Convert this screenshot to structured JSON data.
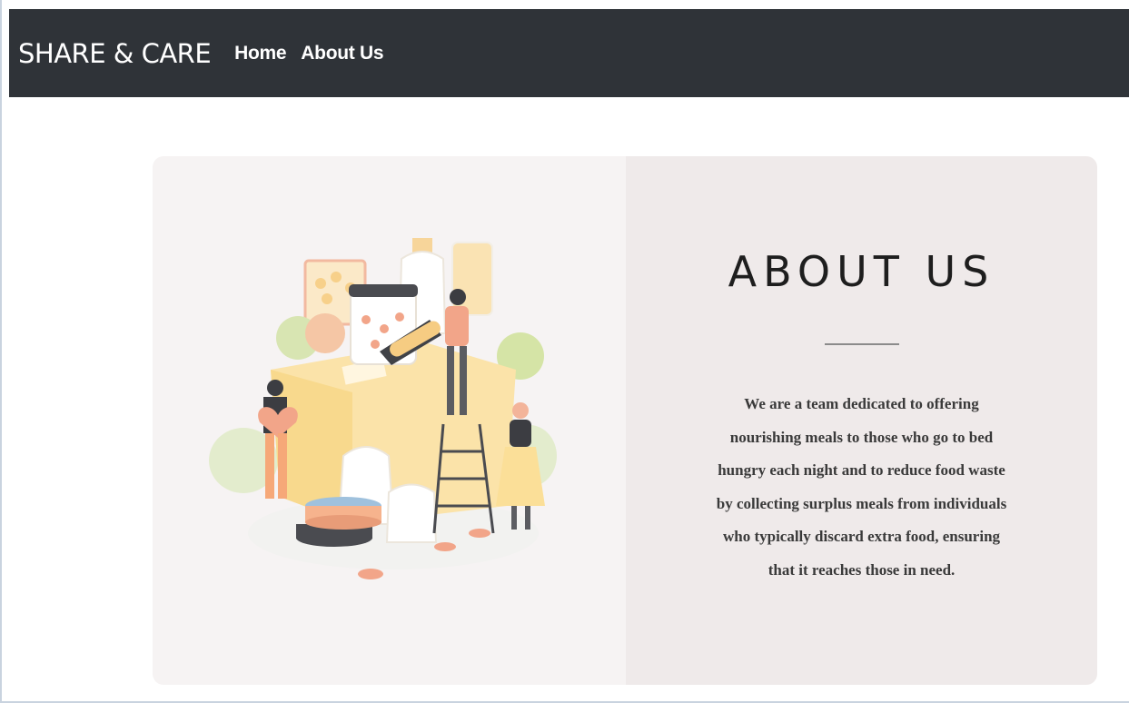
{
  "navbar": {
    "brand": "SHARE & CARE",
    "links": [
      "Home",
      "About Us"
    ]
  },
  "about": {
    "title": "ABOUT US",
    "description": "We are a team dedicated to offering nourishing meals to those who go to bed hungry each night and to reduce food waste by collecting surplus meals from individuals who typically discard extra food, ensuring that it reaches those in need."
  },
  "illustration": {
    "icon": "food-donation-illustration"
  },
  "colors": {
    "navbar_bg": "#2f3338",
    "card_left_bg": "#f6f3f3",
    "card_right_bg": "#efeaea",
    "text_dark": "#1e1e1e"
  }
}
